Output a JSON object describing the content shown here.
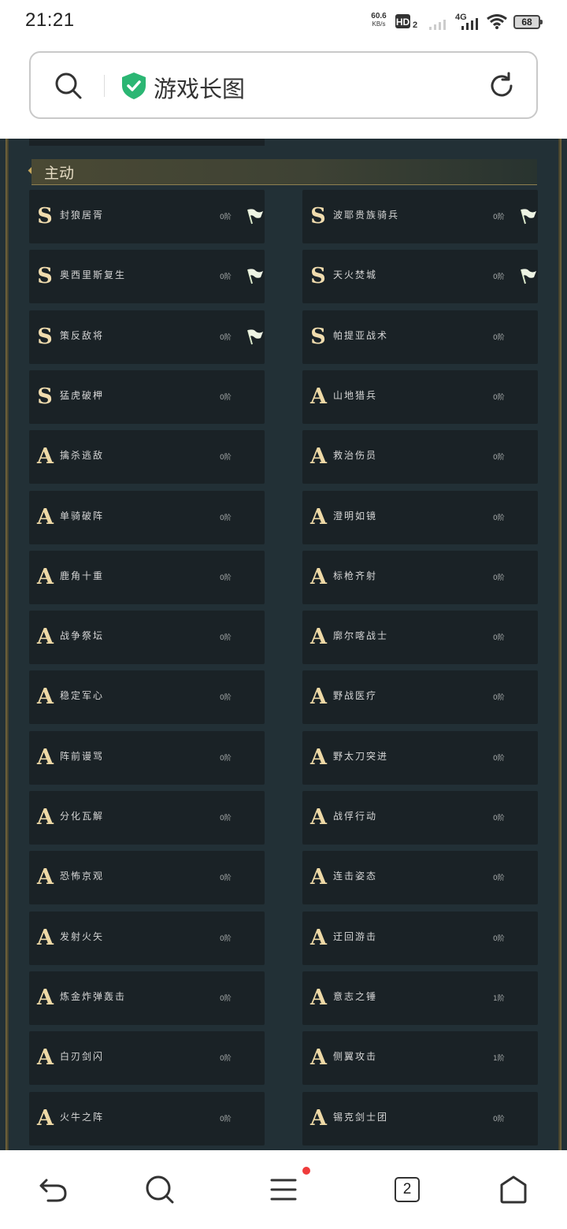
{
  "status_bar": {
    "time": "21:21",
    "net_speed": "60.6",
    "net_speed_unit": "KB/s",
    "hd_label": "HD",
    "hd_sub": "2",
    "network": "4G",
    "battery": "68"
  },
  "search": {
    "text": "游戏长图"
  },
  "section": {
    "title": "主动"
  },
  "skills": [
    {
      "grade": "S",
      "name": "封狼居胥",
      "level": "0阶",
      "flag": true
    },
    {
      "grade": "S",
      "name": "波耶贵族骑兵",
      "level": "0阶",
      "flag": true
    },
    {
      "grade": "S",
      "name": "奥西里斯复生",
      "level": "0阶",
      "flag": true
    },
    {
      "grade": "S",
      "name": "天火焚城",
      "level": "0阶",
      "flag": true
    },
    {
      "grade": "S",
      "name": "策反敌将",
      "level": "0阶",
      "flag": true
    },
    {
      "grade": "S",
      "name": "帕提亚战术",
      "level": "0阶",
      "flag": false
    },
    {
      "grade": "S",
      "name": "猛虎破柙",
      "level": "0阶",
      "flag": false
    },
    {
      "grade": "A",
      "name": "山地猎兵",
      "level": "0阶",
      "flag": false
    },
    {
      "grade": "A",
      "name": "擒杀逃敌",
      "level": "0阶",
      "flag": false
    },
    {
      "grade": "A",
      "name": "救治伤员",
      "level": "0阶",
      "flag": false
    },
    {
      "grade": "A",
      "name": "单骑破阵",
      "level": "0阶",
      "flag": false
    },
    {
      "grade": "A",
      "name": "澄明如镜",
      "level": "0阶",
      "flag": false
    },
    {
      "grade": "A",
      "name": "鹿角十重",
      "level": "0阶",
      "flag": false
    },
    {
      "grade": "A",
      "name": "标枪齐射",
      "level": "0阶",
      "flag": false
    },
    {
      "grade": "A",
      "name": "战争祭坛",
      "level": "0阶",
      "flag": false
    },
    {
      "grade": "A",
      "name": "廓尔喀战士",
      "level": "0阶",
      "flag": false
    },
    {
      "grade": "A",
      "name": "稳定军心",
      "level": "0阶",
      "flag": false
    },
    {
      "grade": "A",
      "name": "野战医疗",
      "level": "0阶",
      "flag": false
    },
    {
      "grade": "A",
      "name": "阵前谩骂",
      "level": "0阶",
      "flag": false
    },
    {
      "grade": "A",
      "name": "野太刀突进",
      "level": "0阶",
      "flag": false
    },
    {
      "grade": "A",
      "name": "分化瓦解",
      "level": "0阶",
      "flag": false
    },
    {
      "grade": "A",
      "name": "战俘行动",
      "level": "0阶",
      "flag": false
    },
    {
      "grade": "A",
      "name": "恐怖京观",
      "level": "0阶",
      "flag": false
    },
    {
      "grade": "A",
      "name": "连击姿态",
      "level": "0阶",
      "flag": false
    },
    {
      "grade": "A",
      "name": "发射火矢",
      "level": "0阶",
      "flag": false
    },
    {
      "grade": "A",
      "name": "迂回游击",
      "level": "0阶",
      "flag": false
    },
    {
      "grade": "A",
      "name": "炼金炸弹轰击",
      "level": "0阶",
      "flag": false
    },
    {
      "grade": "A",
      "name": "意志之锤",
      "level": "1阶",
      "flag": false
    },
    {
      "grade": "A",
      "name": "白刃剑闪",
      "level": "0阶",
      "flag": false
    },
    {
      "grade": "A",
      "name": "侧翼攻击",
      "level": "1阶",
      "flag": false
    },
    {
      "grade": "A",
      "name": "火牛之阵",
      "level": "0阶",
      "flag": false
    },
    {
      "grade": "A",
      "name": "锡克剑士团",
      "level": "0阶",
      "flag": false
    }
  ],
  "bottom_nav": {
    "tab_count": "2"
  },
  "colors": {
    "game_bg": "#223036",
    "card_bg": "#1a2226",
    "grade_gold": "#eed9a6",
    "notify_dot": "#ef3b3b"
  }
}
